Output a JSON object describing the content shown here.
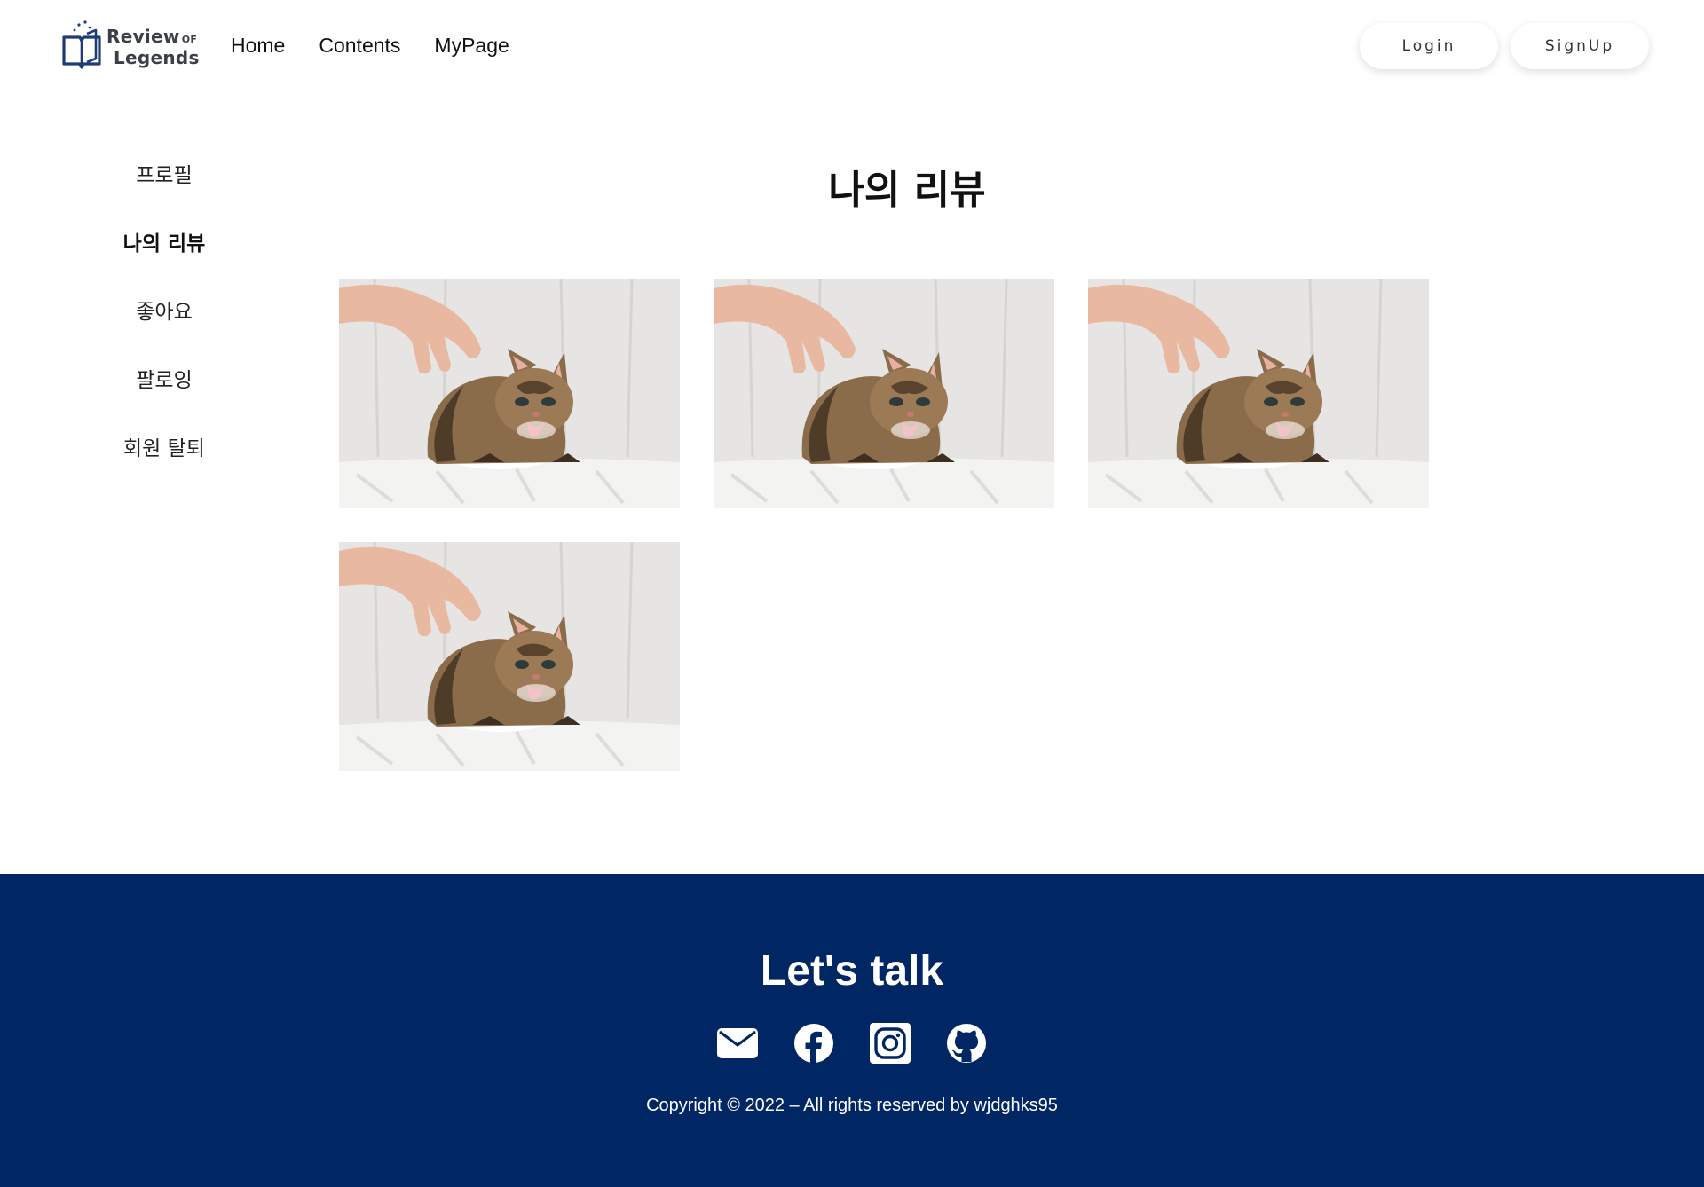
{
  "header": {
    "logo": {
      "line1": "Review",
      "line1_suffix": "OF",
      "line2": "Legends"
    },
    "nav": [
      {
        "label": "Home"
      },
      {
        "label": "Contents"
      },
      {
        "label": "MyPage"
      }
    ],
    "login_label": "Login",
    "signup_label": "SignUp"
  },
  "sidebar": {
    "items": [
      {
        "label": "프로필",
        "active": false
      },
      {
        "label": "나의 리뷰",
        "active": true
      },
      {
        "label": "좋아요",
        "active": false
      },
      {
        "label": "팔로잉",
        "active": false
      },
      {
        "label": "회원 탈퇴",
        "active": false
      }
    ]
  },
  "main": {
    "title": "나의 리뷰",
    "reviews": [
      {
        "image": "kitten-photo"
      },
      {
        "image": "kitten-photo"
      },
      {
        "image": "kitten-photo"
      },
      {
        "image": "kitten-photo"
      }
    ]
  },
  "footer": {
    "title": "Let's talk",
    "socials": [
      {
        "icon": "mail-icon"
      },
      {
        "icon": "facebook-icon"
      },
      {
        "icon": "instagram-icon"
      },
      {
        "icon": "github-icon"
      }
    ],
    "copyright": "Copyright © 2022 – All rights reserved by wjdghks95"
  },
  "colors": {
    "footer_bg": "#002663",
    "text": "#111111",
    "logo_blue": "#1f3c78"
  }
}
